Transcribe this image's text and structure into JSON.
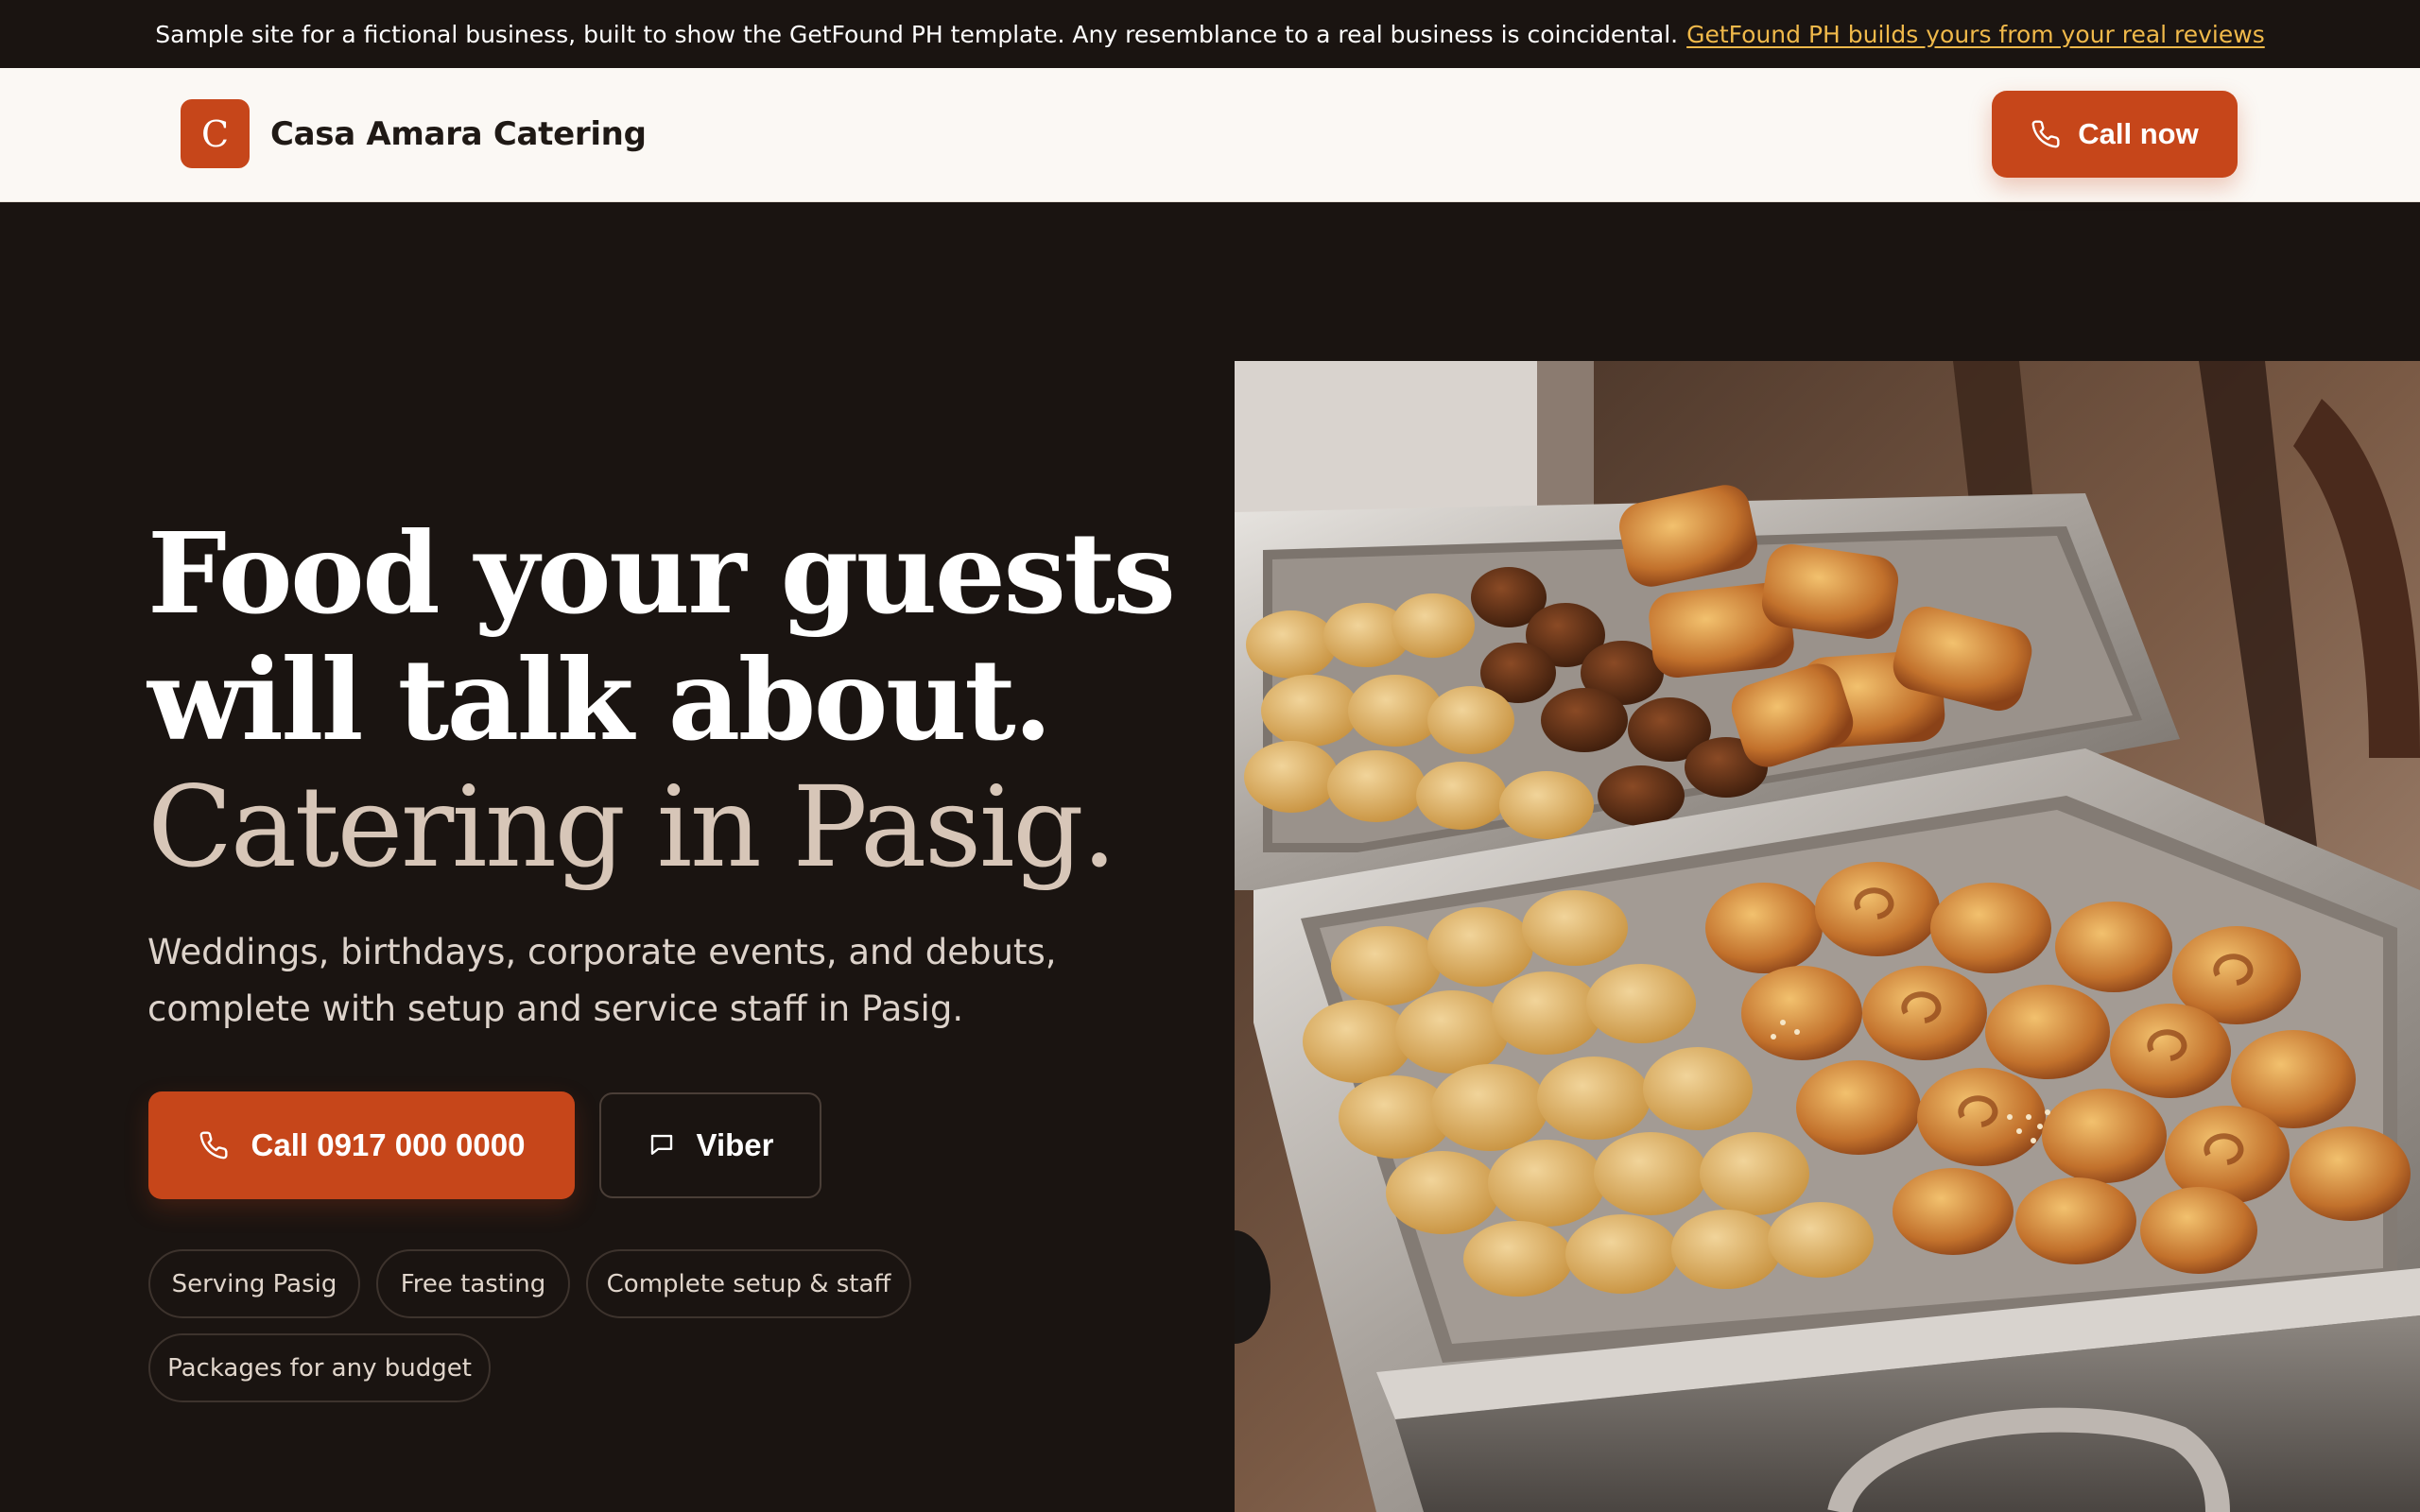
{
  "announcement": {
    "text": "Sample site for a fictional business, built to show the GetFound PH template. Any resemblance to a real business is coincidental.",
    "link_label": "GetFound PH builds yours from your real reviews"
  },
  "header": {
    "logo_letter": "C",
    "brand_name": "Casa Amara Catering",
    "cta_label": "Call now"
  },
  "hero": {
    "headline_line1": "Food your guests",
    "headline_line2": "will talk about.",
    "headline_line3": "Catering in Pasig.",
    "subtitle_line1": "Weddings, birthdays, corporate events, and debuts,",
    "subtitle_line2": "complete with setup and service staff in Pasig.",
    "primary_cta": "Call 0917 000 0000",
    "secondary_cta": "Viber",
    "chips": [
      "Serving Pasig",
      "Free tasting",
      "Complete setup & staff",
      "Packages for any budget"
    ]
  },
  "icons": {
    "phone": "phone-icon",
    "chat": "chat-bubble-icon"
  },
  "colors": {
    "background": "#1a1411",
    "accent": "#c6461a",
    "link": "#f0b94a",
    "header_bg": "#fbf8f4",
    "headline_tan": "#d7c6b8"
  }
}
